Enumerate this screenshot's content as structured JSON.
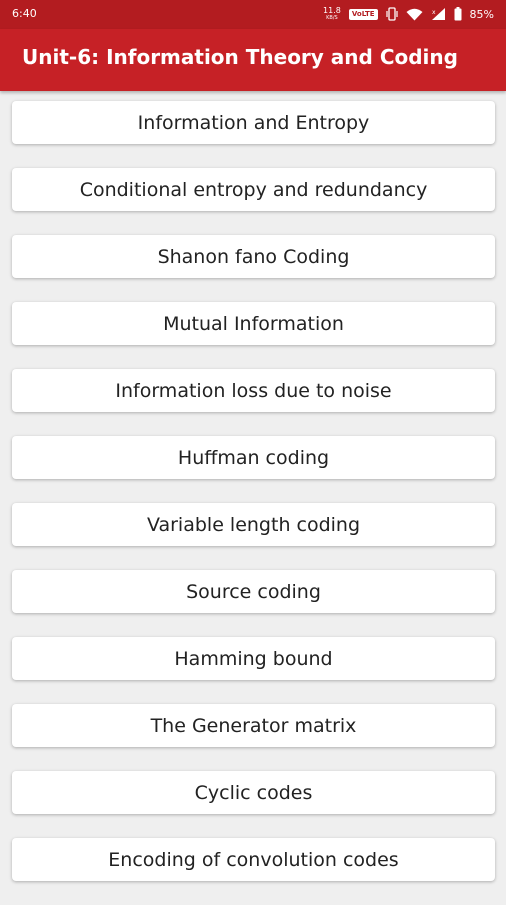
{
  "status_bar": {
    "time": "6:40",
    "net_speed_value": "11.8",
    "net_speed_unit": "KB/S",
    "volte_label": "VoLTE",
    "battery": "85%",
    "icons": [
      "vibrate-icon",
      "wifi-icon",
      "signal-icon",
      "battery-icon"
    ]
  },
  "header": {
    "title": "Unit-6: Information Theory and Coding"
  },
  "topics": [
    "Information and Entropy",
    "Conditional entropy and redundancy",
    "Shanon fano Coding",
    "Mutual Information",
    "Information loss due to noise",
    "Huffman coding",
    "Variable length coding",
    "Source coding",
    "Hamming bound",
    "The Generator matrix",
    "Cyclic codes",
    "Encoding of convolution codes"
  ],
  "colors": {
    "status_bar": "#b31c20",
    "app_bar": "#c62126",
    "background": "#efefef",
    "card": "#ffffff",
    "text": "#222222"
  }
}
